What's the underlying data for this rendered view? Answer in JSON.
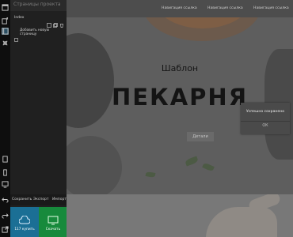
{
  "pages_panel": {
    "title": "Страницы проекта",
    "pages": [
      {
        "name": "Index"
      }
    ],
    "add_page_label": "Добавить новую страницу",
    "bottom_bar": {
      "save_label": "Сохранить",
      "export_label": "Экспорт",
      "import_label": "Импорт"
    },
    "tiles": [
      {
        "label": "117 купить",
        "color": "#1b6f95",
        "icon": "cloud-icon"
      },
      {
        "label": "Скачать",
        "color": "#178a3c",
        "icon": "monitor-icon"
      }
    ]
  },
  "site_nav": {
    "links": [
      "Навигация ссылка",
      "Навигация ссылка",
      "Навигация ссылка"
    ]
  },
  "hero": {
    "subtitle": "Шаблон",
    "title": "ПЕКАРНЯ",
    "button_label": "Детали"
  },
  "modal": {
    "message": "Успешно сохранено",
    "ok_label": "ОК"
  }
}
